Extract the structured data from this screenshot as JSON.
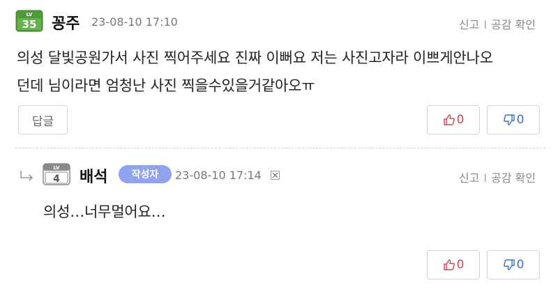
{
  "comment": {
    "level": "35",
    "level_prefix": "LV",
    "nickname": "꽁주",
    "date": "23-08-10 17:10",
    "report_label": "신고",
    "separator": "I",
    "likes_label": "공감 확인",
    "text_line1": "의성 달빛공원가서 사진 찍어주세요 진짜 이뻐요 저는 사진고자라 이쁘게안나오",
    "text_line2": "던데 님이라면 엄청난 사진 찍을수있을거같아오ㅠ",
    "reply_button": "답글",
    "upvotes": "0",
    "downvotes": "0"
  },
  "reply": {
    "arrow_icon": "reply-arrow-icon",
    "level": "4",
    "level_prefix": "LV",
    "nickname": "배석",
    "author_tag": "작성자",
    "date": "23-08-10 17:14",
    "report_label": "신고",
    "separator": "I",
    "likes_label": "공감 확인",
    "text": "의성…너무멀어요…",
    "upvotes": "0",
    "downvotes": "0"
  },
  "colors": {
    "badge_green": "#4e9a38",
    "badge_gray": "#8a8a8a",
    "author_tag": "#8fa3ee",
    "up_red": "#d64545",
    "down_blue": "#3a72c9"
  }
}
